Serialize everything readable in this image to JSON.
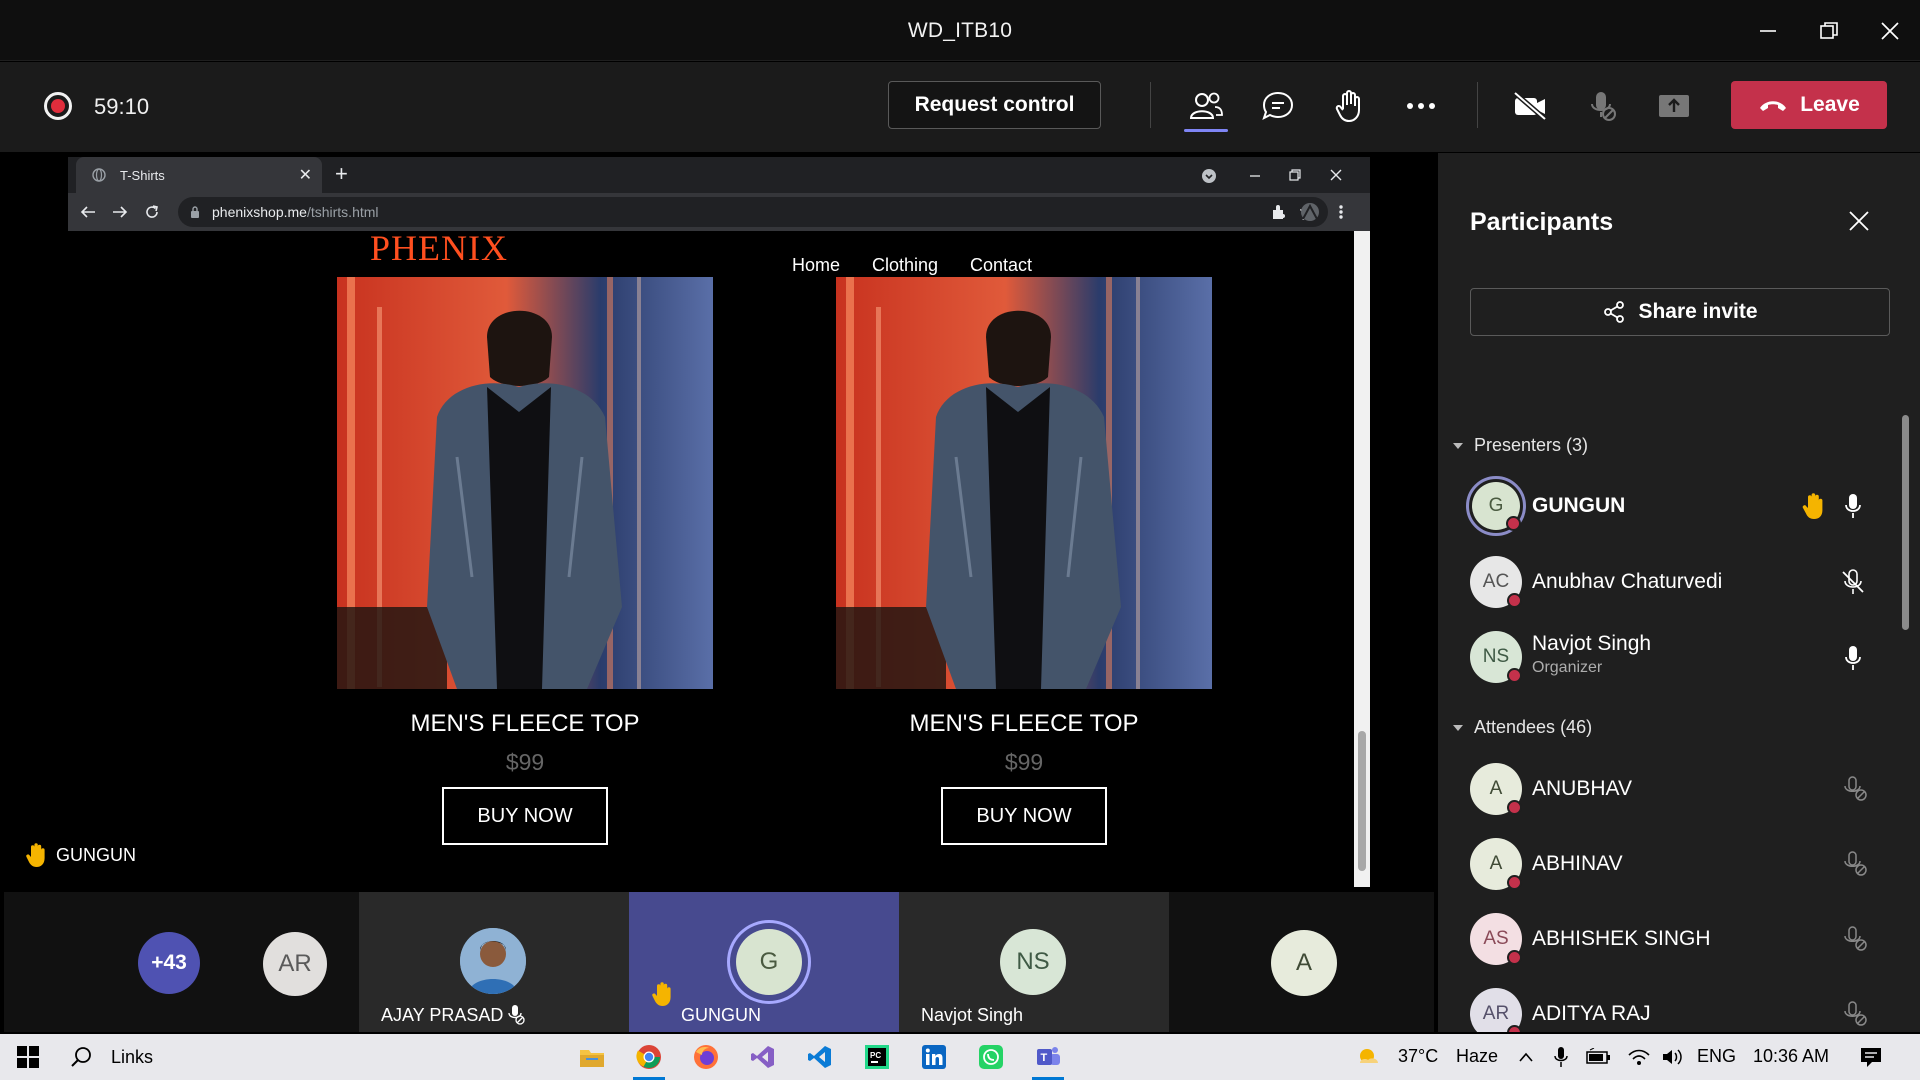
{
  "window": {
    "title": "WD_ITB10"
  },
  "toolbar": {
    "timer": "59:10",
    "request_control": "Request control",
    "leave": "Leave"
  },
  "browser": {
    "tab_title": "T-Shirts",
    "url_domain": "phenixshop.me",
    "url_path": "/tshirts.html"
  },
  "site": {
    "logo": "PHENIX",
    "nav": [
      "Home",
      "Clothing",
      "Contact"
    ],
    "products": [
      {
        "name": "MEN'S FLEECE TOP",
        "price": "$99",
        "button": "BUY NOW"
      },
      {
        "name": "MEN'S FLEECE TOP",
        "price": "$99",
        "button": "BUY NOW"
      }
    ]
  },
  "presenter_label": "GUNGUN",
  "strip": {
    "overflow_count": "+43",
    "tiles": [
      {
        "initials": "AR",
        "name": ""
      },
      {
        "initials": "",
        "name": "AJAY PRASAD"
      },
      {
        "initials": "G",
        "name": "GUNGUN"
      },
      {
        "initials": "NS",
        "name": "Navjot Singh"
      },
      {
        "initials": "A",
        "name": ""
      }
    ]
  },
  "participants": {
    "title": "Participants",
    "share_invite": "Share invite",
    "presenters_header": "Presenters (3)",
    "presenters": [
      {
        "initials": "G",
        "name": "GUNGUN",
        "role": ""
      },
      {
        "initials": "AC",
        "name": "Anubhav Chaturvedi",
        "role": ""
      },
      {
        "initials": "NS",
        "name": "Navjot Singh",
        "role": "Organizer"
      }
    ],
    "attendees_header": "Attendees (46)",
    "attendees": [
      {
        "initials": "A",
        "name": "ANUBHAV"
      },
      {
        "initials": "A",
        "name": "ABHINAV"
      },
      {
        "initials": "AS",
        "name": "ABHISHEK SINGH"
      },
      {
        "initials": "AR",
        "name": "ADITYA RAJ"
      }
    ]
  },
  "taskbar": {
    "search_text": "Links",
    "temperature": "37°C",
    "weather": "Haze",
    "language": "ENG",
    "time": "10:36 AM"
  },
  "colors": {
    "leave_red": "#c4314b",
    "record_red": "#e02d3c",
    "logo_orange": "#ff4f1f",
    "accent_blue": "#0078d4",
    "raise_hand_yellow": "#f5b400"
  }
}
